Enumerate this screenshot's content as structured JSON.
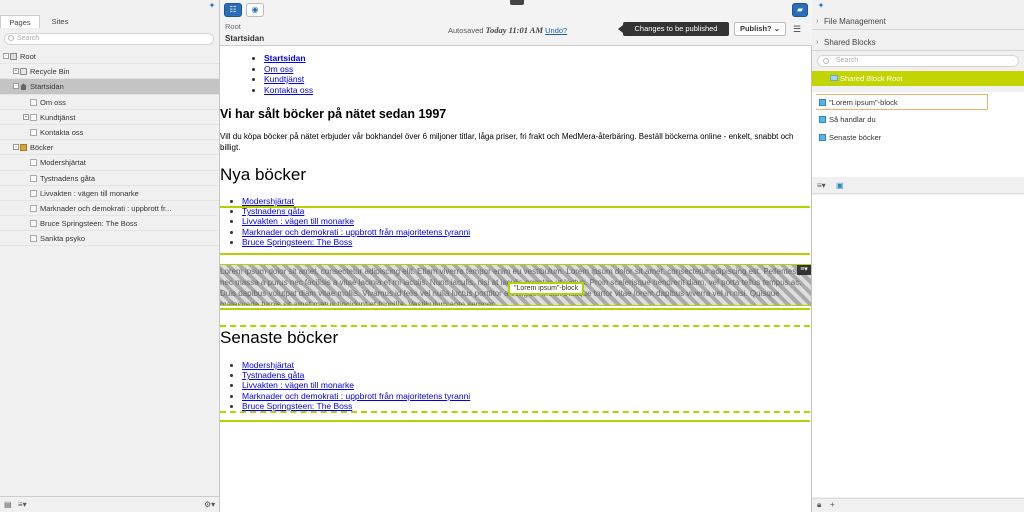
{
  "left": {
    "tabs": [
      "Pages",
      "Sites"
    ],
    "search_placeholder": "Search",
    "tree": [
      {
        "label": "Root",
        "icon": "root-icon",
        "depth": 0,
        "expander": "-"
      },
      {
        "label": "Recycle Bin",
        "icon": "recycle-bin-icon",
        "depth": 1,
        "expander": "+"
      },
      {
        "label": "Startsidan",
        "icon": "home-icon",
        "depth": 1,
        "expander": "-",
        "selected": true
      },
      {
        "label": "Om oss",
        "icon": "page-icon",
        "depth": 2,
        "expander": ""
      },
      {
        "label": "Kundtjänst",
        "icon": "page-icon",
        "depth": 2,
        "expander": "+"
      },
      {
        "label": "Kontakta oss",
        "icon": "page-icon",
        "depth": 2,
        "expander": ""
      },
      {
        "label": "Böcker",
        "icon": "folder-icon",
        "depth": 1,
        "expander": "-"
      },
      {
        "label": "Modershjärtat",
        "icon": "page-icon",
        "depth": 2,
        "expander": ""
      },
      {
        "label": "Tystnadens gåta",
        "icon": "page-icon",
        "depth": 2,
        "expander": ""
      },
      {
        "label": "Livvakten : vägen till monarke",
        "icon": "page-icon",
        "depth": 2,
        "expander": ""
      },
      {
        "label": "Marknader och demokrati : uppbrott fr...",
        "icon": "page-icon",
        "depth": 2,
        "expander": ""
      },
      {
        "label": "Bruce Springsteen: The Boss",
        "icon": "page-icon",
        "depth": 2,
        "expander": ""
      },
      {
        "label": "Sankta psyko",
        "icon": "page-icon",
        "depth": 2,
        "expander": ""
      }
    ]
  },
  "toolbar": {
    "breadcrumb_root": "Root",
    "breadcrumb_page": "Startsidan",
    "autosaved_label": "Autosaved",
    "autosaved_time": "Today 11:01 AM",
    "undo_label": "Undo?",
    "changes_label": "Changes to be published",
    "publish_label": "Publish?",
    "publish_caret": "⌄"
  },
  "content": {
    "menu": [
      "Startsidan",
      "Om oss",
      "Kundtjänst",
      "Kontakta oss"
    ],
    "heading": "Vi har sålt böcker på nätet sedan 1997",
    "intro": "Vill du köpa böcker på nätet erbjuder vår bokhandel över 6 miljoner titlar, låga priser, fri frakt och MedMera-återbäring. Beställ böckerna online - enkelt, snabbt och billigt.",
    "new_books_heading": "Nya böcker",
    "new_books": [
      "Modershjärtat",
      "Tystnadens gåta",
      "Livvakten : vägen till monarke",
      "Marknader och demokrati : uppbrott från majoritetens tyranni",
      "Bruce Springsteen: The Boss"
    ],
    "block_text": "Lorem ipsum dolor sit amet, consectetur adipiscing elit. Etiam viverra tempor enim eu vestibulum. Lorem ipsum dolor sit amet, consectetur adipiscing elit. Pellentesque nec massa a purus nec facilisis a vitae lacinia et mi iaculis. Nunc iaculis, nisi at iaculis egestas ut lectus. Proin scelerisque hendrerit diam, vel porta tellus tempus ac. Duis dapibus volutpat diam vitae mollis. Vivamus id felis vel nulla luctus porttitor a congue. Morbi tristique tortor vitae lorem dapibus viverra vel in nisi. Quisque malesuada turpis sit amet metus tincidunt et fringilla. Vestibulum ante semper.",
    "block_label": "\"Lorem ipsum\"-block",
    "latest_heading": "Senaste böcker",
    "latest_books": [
      "Modershjärtat",
      "Tystnadens gåta",
      "Livvakten : vägen till monarke",
      "Marknader och demokrati : uppbrott från majoritetens tyranni",
      "Bruce Springsteen: The Boss"
    ]
  },
  "right": {
    "file_management": "File Management",
    "shared_blocks": "Shared Blocks",
    "search_placeholder": "Search",
    "shared_block_root": "Shared Block Root",
    "blocks": [
      "\"Lorem ipsum\"-block",
      "Så handlar du",
      "Senaste böcker"
    ]
  },
  "colors": {
    "accent_green": "#b6d000",
    "selection_green": "#c4d400",
    "accent_blue": "#2a6ebb"
  }
}
